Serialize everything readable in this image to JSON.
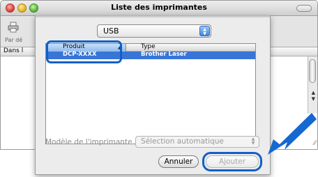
{
  "window": {
    "title": "Liste des imprimantes",
    "toolbar_label": "Par dé",
    "list_header_label": "Dans l"
  },
  "sheet": {
    "connection_type": "USB",
    "columns": {
      "product": "Produit",
      "type": "Type"
    },
    "rows": [
      {
        "product": "DCP-XXXX",
        "type": "Brother Laser",
        "selected": true
      }
    ],
    "model_label": "Modèle de l'imprimante :",
    "model_value": "Sélection automatique",
    "cancel_label": "Annuler",
    "add_label": "Ajouter"
  },
  "colors": {
    "selection": "#3875d7",
    "highlight": "#1060c8",
    "arrow": "#1568d0"
  }
}
